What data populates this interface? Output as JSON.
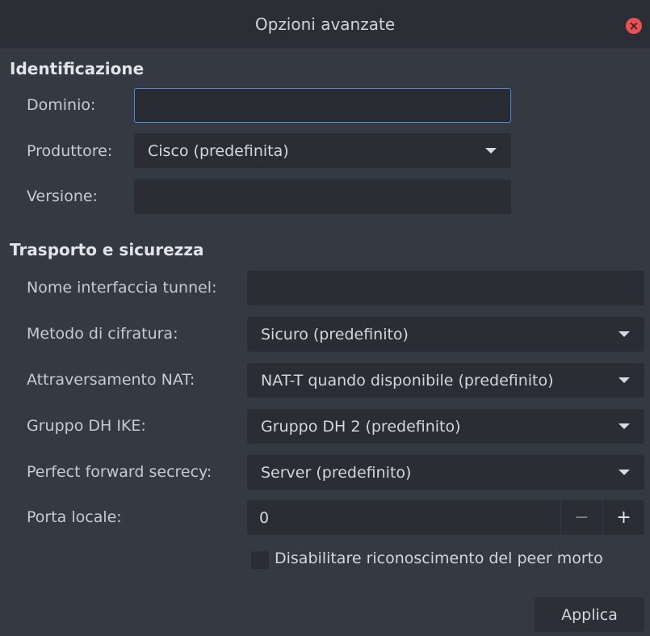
{
  "window": {
    "title": "Opzioni avanzate"
  },
  "identificazione": {
    "section_title": "Identificazione",
    "dominio": {
      "label": "Dominio:",
      "value": ""
    },
    "produttore": {
      "label": "Produttore:",
      "value": "Cisco (predefinita)"
    },
    "versione": {
      "label": "Versione:",
      "value": ""
    }
  },
  "trasporto": {
    "section_title": "Trasporto e sicurezza",
    "nome_interfaccia": {
      "label": "Nome interfaccia tunnel:",
      "value": ""
    },
    "metodo_cifratura": {
      "label": "Metodo di cifratura:",
      "value": "Sicuro (predefinito)"
    },
    "nat": {
      "label": "Attraversamento NAT:",
      "value": "NAT-T quando disponibile (predefinito)"
    },
    "dh": {
      "label": "Gruppo DH IKE:",
      "value": "Gruppo DH 2 (predefinito)"
    },
    "pfs": {
      "label": "Perfect forward secrecy:",
      "value": "Server (predefinito)"
    },
    "porta": {
      "label": "Porta locale:",
      "value": "0",
      "minus": "−",
      "plus": "+"
    },
    "dpd": {
      "label": "Disabilitare riconoscimento del peer morto",
      "checked": false
    }
  },
  "footer": {
    "apply_label": "Applica"
  },
  "colors": {
    "accent": "#4a8ad3",
    "close": "#ea4f51",
    "background": "#353a42"
  },
  "icons": {
    "close": "close-icon",
    "dropdown": "chevron-down-icon"
  }
}
